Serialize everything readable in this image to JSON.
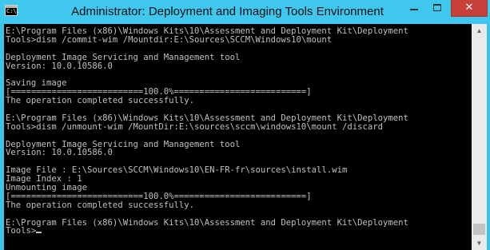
{
  "window": {
    "title": "Administrator: Deployment and Imaging Tools Environment",
    "icon": "console-icon",
    "icon_glyph": "C:\\.",
    "controls": {
      "minimize": "minimize-icon",
      "maximize": "maximize-icon",
      "close": "✕"
    }
  },
  "console": {
    "lines": [
      "E:\\Program Files (x86)\\Windows Kits\\10\\Assessment and Deployment Kit\\Deployment",
      "Tools>dism /commit-wim /Mountdir:E:\\Sources\\SCCM\\Windows10\\mount",
      "",
      "Deployment Image Servicing and Management tool",
      "Version: 10.0.10586.0",
      "",
      "Saving image",
      "[==========================100.0%==========================]",
      "The operation completed successfully.",
      "",
      "E:\\Program Files (x86)\\Windows Kits\\10\\Assessment and Deployment Kit\\Deployment",
      "Tools>dism /unmount-wim /MountDir:E:\\sources\\sccm\\windows10\\mount /discard",
      "",
      "Deployment Image Servicing and Management tool",
      "Version: 10.0.10586.0",
      "",
      "Image File : E:\\Sources\\SCCM\\Windows10\\EN-FR-fr\\sources\\install.wim",
      "Image Index : 1",
      "Unmounting image",
      "[==========================100.0%==========================]",
      "The operation completed successfully.",
      "",
      "E:\\Program Files (x86)\\Windows Kits\\10\\Assessment and Deployment Kit\\Deployment",
      "Tools>"
    ]
  },
  "scrollbar": {
    "up_arrow": "▲",
    "down_arrow": "▼"
  },
  "colors": {
    "frame": "#3cc5ea",
    "console_bg": "#000000",
    "console_fg": "#c0c0c0",
    "close_button": "#c7403a"
  }
}
